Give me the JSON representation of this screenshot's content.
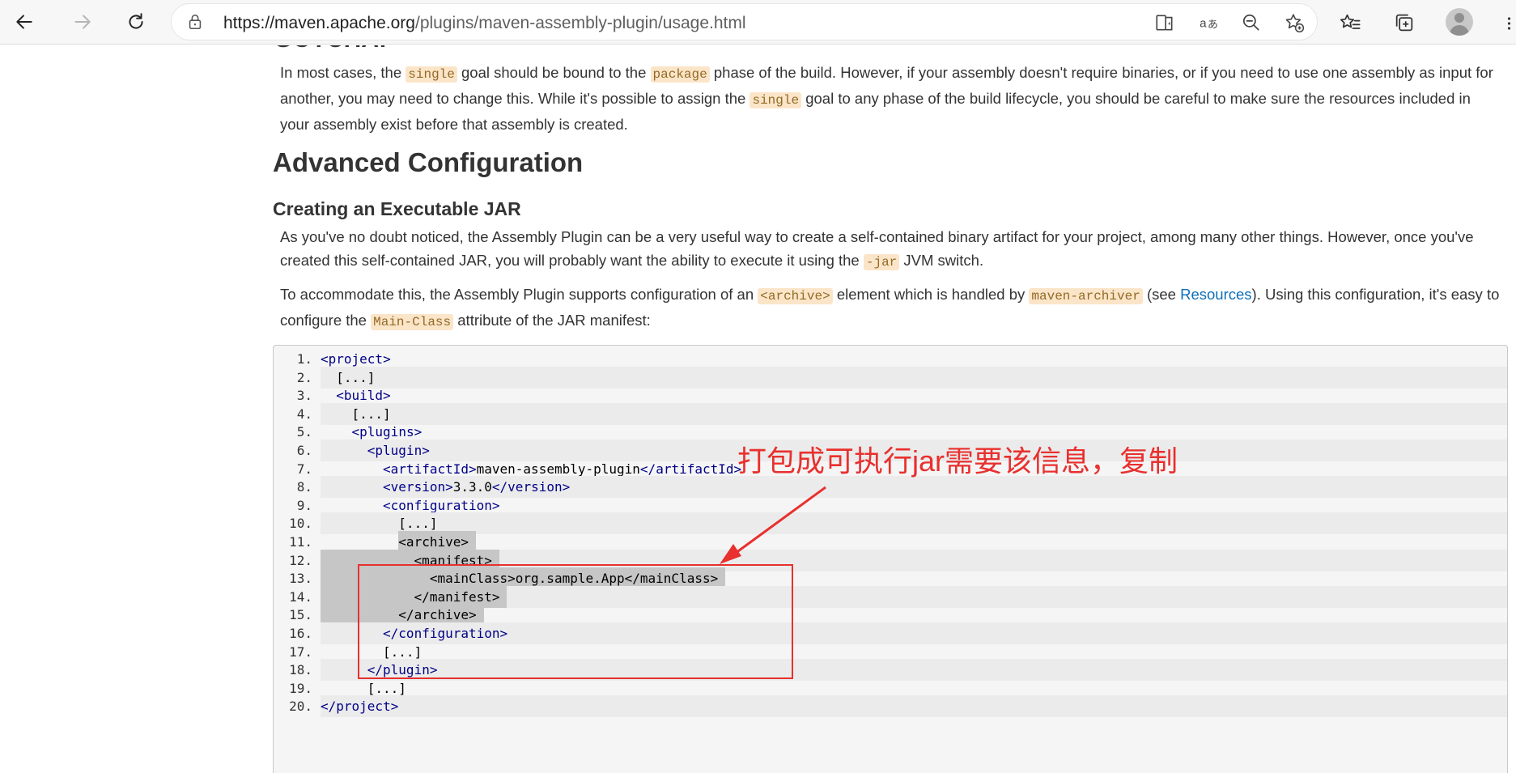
{
  "browser": {
    "url_host": "https://maven.apache.org",
    "url_path": "/plugins/maven-assembly-plugin/usage.html"
  },
  "page": {
    "cut_heading": "GOTCHA!",
    "gotcha_para": [
      {
        "t": "In most cases, the "
      },
      {
        "c": "single"
      },
      {
        "t": " goal should be bound to the "
      },
      {
        "c": "package"
      },
      {
        "t": " phase of the build. However, if your assembly doesn't require binaries, or if you need to use one assembly as input for another, you may need to change this. While it's possible to assign the "
      },
      {
        "c": "single"
      },
      {
        "t": " goal to any phase of the build lifecycle, you should be careful to make sure the resources included in your assembly exist before that assembly is created."
      }
    ],
    "h2": "Advanced Configuration",
    "h3": "Creating an Executable JAR",
    "para1": [
      {
        "t": "As you've no doubt noticed, the Assembly Plugin can be a very useful way to create a self-contained binary artifact for your project, among many other things. However, once you've created this self-contained JAR, you will probably want the ability to execute it using the "
      },
      {
        "c": "-jar"
      },
      {
        "t": " JVM switch."
      }
    ],
    "para2": [
      {
        "t": "To accommodate this, the Assembly Plugin supports configuration of an "
      },
      {
        "c": "<archive>"
      },
      {
        "t": " element which is handled by "
      },
      {
        "c": "maven-archiver"
      },
      {
        "t": " (see "
      },
      {
        "a": "Resources"
      },
      {
        "t": "). Using this configuration, it's easy to configure the "
      },
      {
        "c": "Main-Class"
      },
      {
        "t": " attribute of the JAR manifest:"
      }
    ]
  },
  "code_lines": [
    {
      "num": "1.",
      "indent": 0,
      "parts": [
        {
          "k": "tag",
          "v": "<project>"
        }
      ]
    },
    {
      "num": "2.",
      "indent": 2,
      "parts": [
        {
          "k": "txt",
          "v": "[...]"
        }
      ]
    },
    {
      "num": "3.",
      "indent": 2,
      "parts": [
        {
          "k": "tag",
          "v": "<build>"
        }
      ]
    },
    {
      "num": "4.",
      "indent": 4,
      "parts": [
        {
          "k": "txt",
          "v": "[...]"
        }
      ]
    },
    {
      "num": "5.",
      "indent": 4,
      "parts": [
        {
          "k": "tag",
          "v": "<plugins>"
        }
      ]
    },
    {
      "num": "6.",
      "indent": 6,
      "parts": [
        {
          "k": "tag",
          "v": "<plugin>"
        }
      ]
    },
    {
      "num": "7.",
      "indent": 8,
      "parts": [
        {
          "k": "tag",
          "v": "<artifactId>"
        },
        {
          "k": "txt",
          "v": "maven-assembly-plugin"
        },
        {
          "k": "tag",
          "v": "</artifactId>"
        }
      ]
    },
    {
      "num": "8.",
      "indent": 8,
      "parts": [
        {
          "k": "tag",
          "v": "<version>"
        },
        {
          "k": "txt",
          "v": "3.3.0"
        },
        {
          "k": "tag",
          "v": "</version>"
        }
      ]
    },
    {
      "num": "9.",
      "indent": 8,
      "parts": [
        {
          "k": "tag",
          "v": "<configuration>"
        }
      ]
    },
    {
      "num": "10.",
      "indent": 10,
      "parts": [
        {
          "k": "txt",
          "v": "[...]"
        }
      ]
    },
    {
      "num": "11.",
      "indent": 10,
      "parts": [
        {
          "k": "txt",
          "v": "<archive>"
        }
      ],
      "selected": true
    },
    {
      "num": "12.",
      "indent": 12,
      "parts": [
        {
          "k": "txt",
          "v": "<manifest>"
        }
      ],
      "selected": true
    },
    {
      "num": "13.",
      "indent": 14,
      "parts": [
        {
          "k": "txt",
          "v": "<mainClass>org.sample.App</mainClass>"
        }
      ],
      "selected": true
    },
    {
      "num": "14.",
      "indent": 12,
      "parts": [
        {
          "k": "txt",
          "v": "</manifest>"
        }
      ],
      "selected": true
    },
    {
      "num": "15.",
      "indent": 10,
      "parts": [
        {
          "k": "txt",
          "v": "</archive>"
        }
      ],
      "selected": true
    },
    {
      "num": "16.",
      "indent": 8,
      "parts": [
        {
          "k": "tag",
          "v": "</configuration>"
        }
      ]
    },
    {
      "num": "17.",
      "indent": 8,
      "parts": [
        {
          "k": "txt",
          "v": "[...]"
        }
      ]
    },
    {
      "num": "18.",
      "indent": 6,
      "parts": [
        {
          "k": "tag",
          "v": "</plugin>"
        }
      ]
    },
    {
      "num": "19.",
      "indent": 6,
      "parts": [
        {
          "k": "txt",
          "v": "[...]"
        }
      ]
    },
    {
      "num": "20.",
      "indent": 0,
      "parts": [
        {
          "k": "tag",
          "v": "</project>"
        }
      ]
    }
  ],
  "annotation": {
    "text": "打包成可执行jar需要该信息，复制",
    "color": "#e8302e"
  },
  "colors": {
    "link": "#0d6fb8",
    "code_bg": "#fbe5c9",
    "code_fg": "#946a24",
    "xml_tag": "#000088",
    "selection": "#c6c6c6"
  },
  "icons": [
    "back-arrow-icon",
    "forward-arrow-icon",
    "refresh-icon",
    "lock-icon",
    "read-aloud-icon",
    "translate-icon",
    "zoom-out-icon",
    "add-favorite-icon",
    "favorites-icon",
    "collections-icon",
    "profile-avatar",
    "more-icon"
  ]
}
